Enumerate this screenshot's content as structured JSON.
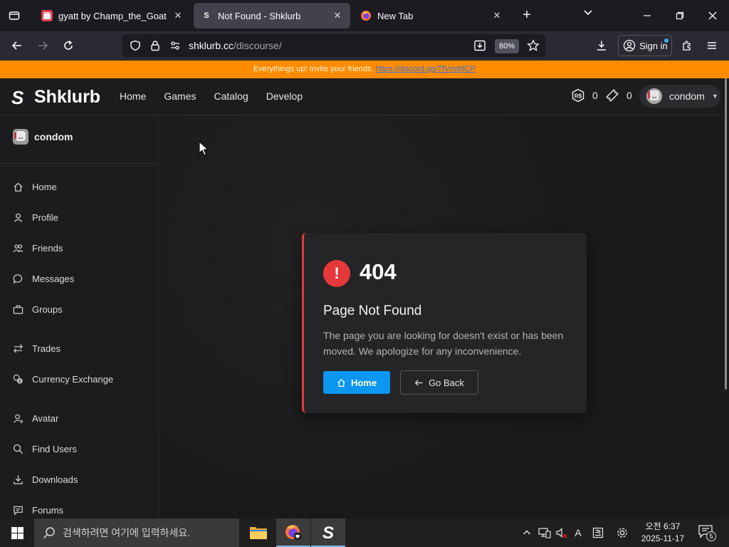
{
  "browser": {
    "tabs": [
      {
        "title": "gyatt by Champ_the_Goat",
        "close": "✕"
      },
      {
        "title": "Not Found - Shklurb",
        "close": "✕"
      },
      {
        "title": "New Tab",
        "close": "✕"
      }
    ],
    "new_tab": "+",
    "url_domain": "shklurb.cc",
    "url_path": "/discourse/",
    "zoom": "80%",
    "sign_in": "Sign in"
  },
  "banner": {
    "text": "Everythings up! Invite your friends. ",
    "link": "https://discord.gg/TfVm6tfCP"
  },
  "site": {
    "brand": "Shklurb",
    "nav": [
      "Home",
      "Games",
      "Catalog",
      "Develop"
    ],
    "robux_label": "R$",
    "robux": "0",
    "tickets": "0",
    "username": "condom"
  },
  "sidebar": {
    "username": "condom",
    "items": [
      {
        "label": "Home",
        "icon": "home-icon"
      },
      {
        "label": "Profile",
        "icon": "profile-icon"
      },
      {
        "label": "Friends",
        "icon": "friends-icon"
      },
      {
        "label": "Messages",
        "icon": "messages-icon"
      },
      {
        "label": "Groups",
        "icon": "groups-icon"
      },
      {
        "label": "Trades",
        "icon": "trades-icon"
      },
      {
        "label": "Currency Exchange",
        "icon": "currency-exchange-icon"
      },
      {
        "label": "Avatar",
        "icon": "avatar-icon"
      },
      {
        "label": "Find Users",
        "icon": "find-users-icon"
      },
      {
        "label": "Downloads",
        "icon": "downloads-icon"
      },
      {
        "label": "Forums",
        "icon": "forums-icon"
      }
    ]
  },
  "error": {
    "code": "404",
    "title": "Page Not Found",
    "message": "The page you are looking for doesn't exist or has been moved. We apologize for any inconvenience.",
    "home_button": "Home",
    "back_button": "Go Back",
    "accent_color": "#e5383b"
  },
  "taskbar": {
    "search_placeholder": "검색하려면 여기에 입력하세요.",
    "time": "오전 6:37",
    "date": "2025-11-17",
    "notifications": "5",
    "ime": "A"
  },
  "colors": {
    "banner": "#ff8c00",
    "primary_button": "#0b96f0",
    "background": "#1b1b1d"
  }
}
